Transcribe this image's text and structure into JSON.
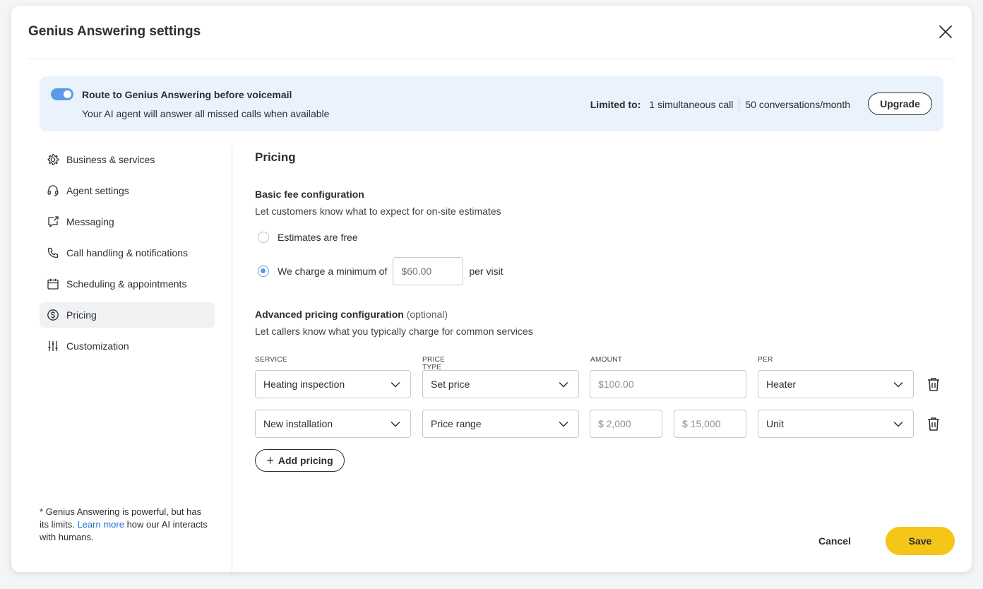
{
  "modal": {
    "title": "Genius Answering settings",
    "close_icon": "close-icon"
  },
  "banner": {
    "toggle_on": true,
    "title": "Route to Genius Answering before voicemail",
    "description": "Your AI agent will answer all missed calls when available",
    "limits_label": "Limited to:",
    "limit_calls": "1 simultaneous call",
    "limit_conversations": "50 conversations/month",
    "upgrade_label": "Upgrade"
  },
  "sidebar": {
    "items": [
      {
        "label": "Business & services",
        "icon": "gear-icon"
      },
      {
        "label": "Agent settings",
        "icon": "headset-icon"
      },
      {
        "label": "Messaging",
        "icon": "message-icon"
      },
      {
        "label": "Call handling & notifications",
        "icon": "phone-icon"
      },
      {
        "label": "Scheduling & appointments",
        "icon": "calendar-icon"
      },
      {
        "label": "Pricing",
        "icon": "dollar-icon",
        "active": true
      },
      {
        "label": "Customization",
        "icon": "sliders-icon"
      }
    ],
    "footer_prefix": "Genius Answering is powerful, but has its limits.",
    "footer_link": "Learn more",
    "footer_suffix": "how our AI interacts with humans."
  },
  "pricing": {
    "heading": "Pricing",
    "basic": {
      "title": "Basic fee configuration",
      "description": "Let customers know what to expect for on-site estimates",
      "option_free": "Estimates are free",
      "option_charge_prefix": "We charge a minimum of",
      "charge_placeholder": "$60.00",
      "option_charge_suffix": "per visit",
      "selected": "charge"
    },
    "advanced": {
      "title": "Advanced pricing configuration",
      "optional": "(optional)",
      "description": "Let callers know what you typically charge for common services",
      "columns": [
        "SERVICE",
        "PRICE TYPE",
        "AMOUNT",
        "PER"
      ],
      "rows": [
        {
          "service": "Heating inspection",
          "price_type": "Set price",
          "amount": "$100.00",
          "per": "Heater"
        },
        {
          "service": "New installation",
          "price_type": "Price range",
          "amount_min": "$ 2,000",
          "amount_max": "$ 15,000",
          "per": "Unit"
        }
      ],
      "add_label": "Add pricing"
    }
  },
  "footer": {
    "cancel_label": "Cancel",
    "save_label": "Save"
  },
  "colors": {
    "accent": "#5b9be6",
    "save": "#f5c518",
    "banner_bg": "#eaf2fc",
    "link": "#1a6fd1"
  }
}
